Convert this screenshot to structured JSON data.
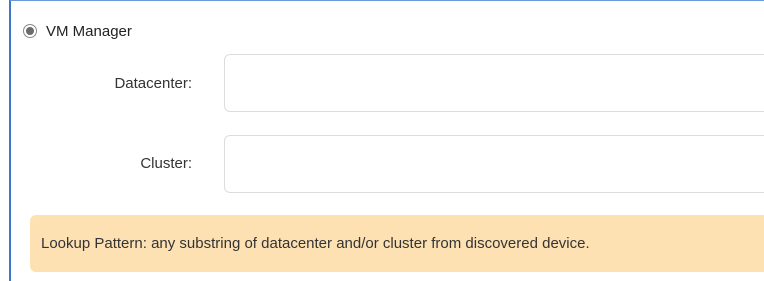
{
  "vm_manager": {
    "label": "VM Manager",
    "selected": true
  },
  "fields": {
    "datacenter": {
      "label": "Datacenter:",
      "value": "",
      "placeholder": ""
    },
    "cluster": {
      "label": "Cluster:",
      "value": "",
      "placeholder": ""
    }
  },
  "info": {
    "text": "Lookup Pattern: any substring of datacenter and/or cluster from discovered device."
  },
  "colors": {
    "panel_border": "#3b78c9",
    "info_background": "#fde1b3",
    "input_border": "#dcdcdc"
  }
}
